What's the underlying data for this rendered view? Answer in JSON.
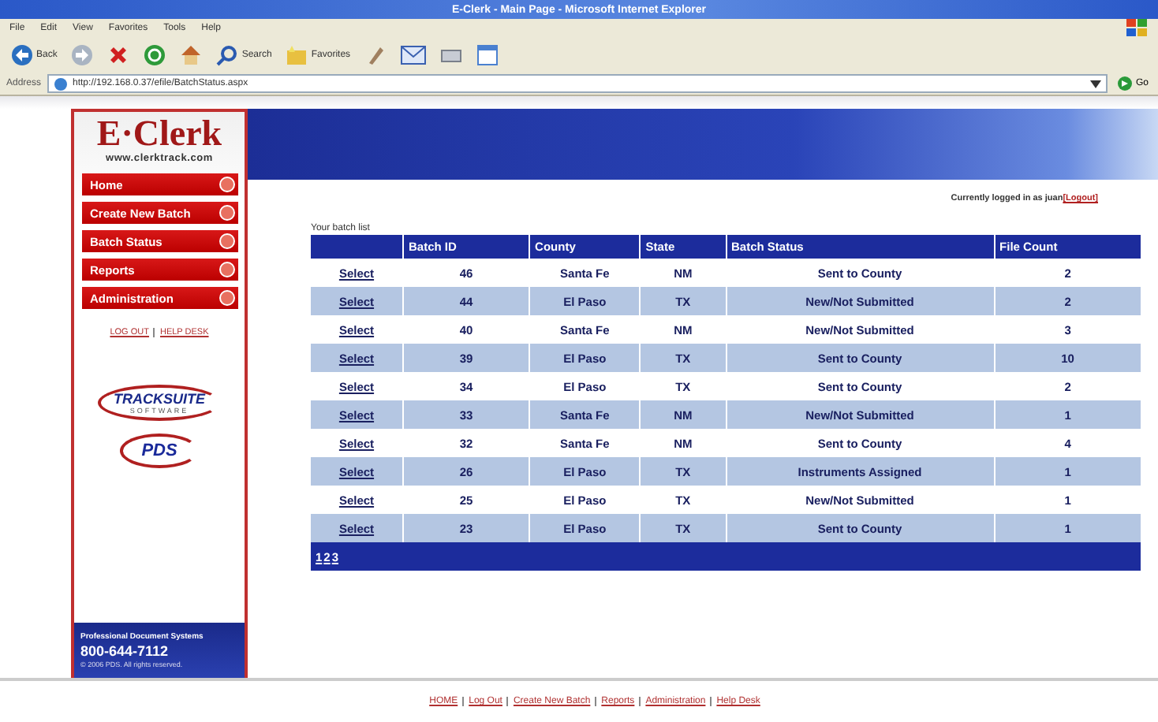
{
  "window": {
    "title": "E-Clerk - Main Page - Microsoft Internet Explorer"
  },
  "menu": [
    "File",
    "Edit",
    "View",
    "Favorites",
    "Tools",
    "Help"
  ],
  "toolbar": [
    {
      "kind": "back",
      "label": "Back"
    },
    {
      "kind": "forward"
    },
    {
      "kind": "stop"
    },
    {
      "kind": "refresh"
    },
    {
      "kind": "home"
    },
    {
      "kind": "search",
      "label": "Search"
    },
    {
      "kind": "favorites",
      "label": "Favorites"
    },
    {
      "kind": "history"
    },
    {
      "kind": "mail"
    },
    {
      "kind": "print"
    },
    {
      "kind": "window"
    }
  ],
  "address": {
    "label": "Address",
    "value": "http://192.168.0.37/efile/BatchStatus.aspx",
    "go": "Go"
  },
  "sidebar": {
    "logo": {
      "title": "E·Clerk",
      "url": "www.clerktrack.com"
    },
    "nav": [
      "Home",
      "Create New Batch",
      "Batch Status",
      "Reports",
      "Administration"
    ],
    "links": [
      "LOG OUT",
      "HELP DESK"
    ],
    "partners": [
      {
        "kind": "tracksuite",
        "name": "TRACKSUITE",
        "tagline": "SOFTWARE"
      },
      {
        "kind": "pds",
        "name": "PDS"
      }
    ],
    "contact": {
      "company": "Professional Document Systems",
      "phone": "800-644-7112",
      "copyright": "© 2006 PDS.  All rights reserved."
    }
  },
  "session": {
    "text": "Currently logged in as juan",
    "link": "[Logout]"
  },
  "table": {
    "caption": "Your batch list",
    "columns": [
      "Batch ID",
      "County",
      "State",
      "Batch Status",
      "File Count"
    ],
    "rows": [
      {
        "action": "Select",
        "batch_id": "46",
        "county": "Santa Fe",
        "state": "NM",
        "status": "Sent to County",
        "file_count": "2"
      },
      {
        "action": "Select",
        "batch_id": "44",
        "county": "El Paso",
        "state": "TX",
        "status": "New/Not Submitted",
        "file_count": "2"
      },
      {
        "action": "Select",
        "batch_id": "40",
        "county": "Santa Fe",
        "state": "NM",
        "status": "New/Not Submitted",
        "file_count": "3"
      },
      {
        "action": "Select",
        "batch_id": "39",
        "county": "El Paso",
        "state": "TX",
        "status": "Sent to County",
        "file_count": "10"
      },
      {
        "action": "Select",
        "batch_id": "34",
        "county": "El Paso",
        "state": "TX",
        "status": "Sent to County",
        "file_count": "2"
      },
      {
        "action": "Select",
        "batch_id": "33",
        "county": "Santa Fe",
        "state": "NM",
        "status": "New/Not Submitted",
        "file_count": "1"
      },
      {
        "action": "Select",
        "batch_id": "32",
        "county": "Santa Fe",
        "state": "NM",
        "status": "Sent to County",
        "file_count": "4"
      },
      {
        "action": "Select",
        "batch_id": "26",
        "county": "El Paso",
        "state": "TX",
        "status": "Instruments Assigned",
        "file_count": "1"
      },
      {
        "action": "Select",
        "batch_id": "25",
        "county": "El Paso",
        "state": "TX",
        "status": "New/Not Submitted",
        "file_count": "1"
      },
      {
        "action": "Select",
        "batch_id": "23",
        "county": "El Paso",
        "state": "TX",
        "status": "Sent to County",
        "file_count": "1"
      }
    ],
    "pages": [
      "1",
      "2",
      "3"
    ]
  },
  "footer_links": [
    "HOME",
    "Log Out",
    "Create New Batch",
    "Reports",
    "Administration",
    "Help Desk"
  ]
}
